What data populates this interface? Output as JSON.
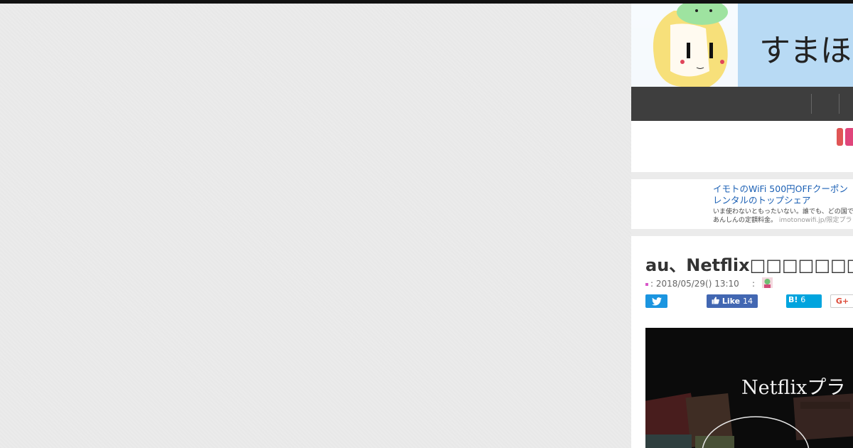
{
  "site": {
    "banner_title": "すまほん"
  },
  "ad": {
    "title_line1": "イモトのWiFi 500円OFFクーポン",
    "title_line2": "レンタルのトップシェア",
    "desc_line1": "いま使わないともったいない。誰でも、どの国で",
    "desc_line2": "あんしんの定額料金。",
    "url": "imotonowifi.jp/限定プラ"
  },
  "article": {
    "title": "au、Netflix□□□□□□□□□□□□□",
    "date": ": 2018/05/29() 13:10",
    "author_sep": ":",
    "hero_text": "Netflixプラ"
  },
  "share": {
    "facebook_label": "Like",
    "facebook_count": "14",
    "hatena_label": "B!",
    "hatena_count": "6",
    "gplus_label": "G+"
  },
  "colors": {
    "twitter": "#1b95e0",
    "facebook": "#4267b2",
    "hatena": "#00a4de",
    "navbar": "#3e3e3e"
  }
}
